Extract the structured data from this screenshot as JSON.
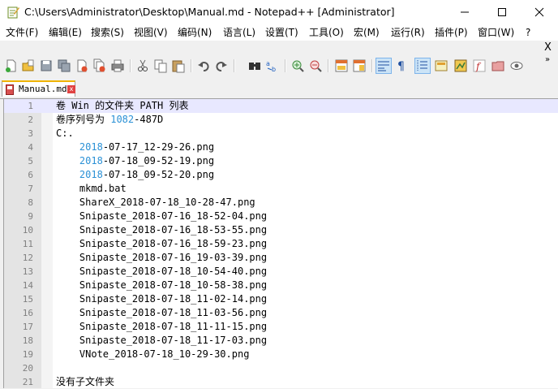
{
  "window": {
    "title": "C:\\Users\\Administrator\\Desktop\\Manual.md - Notepad++ [Administrator]",
    "icon": "notepad-app-icon"
  },
  "menu": {
    "items": [
      "文件(F)",
      "编辑(E)",
      "搜索(S)",
      "视图(V)",
      "编码(N)",
      "语言(L)",
      "设置(T)",
      "工具(O)",
      "宏(M)",
      "运行(R)",
      "插件(P)",
      "窗口(W)",
      "?"
    ],
    "close_doc": "X"
  },
  "toolbar": {
    "buttons": [
      "new-file-icon",
      "open-file-icon",
      "save-icon",
      "save-all-icon",
      "close-icon",
      "close-all-icon",
      "print-icon",
      "cut-icon",
      "copy-icon",
      "paste-icon",
      "undo-icon",
      "redo-icon",
      "find-icon",
      "replace-icon",
      "zoom-in-icon",
      "zoom-out-icon",
      "sync-vertical-icon",
      "sync-horizontal-icon",
      "word-wrap-icon",
      "show-all-chars-icon",
      "indent-guide-icon",
      "doc-map-icon",
      "function-list-icon",
      "folder-workspace-icon",
      "monitoring-icon",
      "record-macro-icon"
    ],
    "overflow": "»"
  },
  "tabs": [
    {
      "label": "Manual.md",
      "close": "x"
    }
  ],
  "editor": {
    "lines": [
      {
        "no": "1",
        "text": "卷 Win 的文件夹 PATH 列表"
      },
      {
        "no": "2",
        "pre": "卷序列号为 ",
        "num": "1082",
        "post": "-487D"
      },
      {
        "no": "3",
        "text": "C:."
      },
      {
        "no": "4",
        "pre": "    ",
        "num": "2018",
        "post": "-07-17_12-29-26.png"
      },
      {
        "no": "5",
        "pre": "    ",
        "num": "2018",
        "post": "-07-18_09-52-19.png"
      },
      {
        "no": "6",
        "pre": "    ",
        "num": "2018",
        "post": "-07-18_09-52-20.png"
      },
      {
        "no": "7",
        "text": "    mkmd.bat"
      },
      {
        "no": "8",
        "text": "    ShareX_2018-07-18_10-28-47.png"
      },
      {
        "no": "9",
        "text": "    Snipaste_2018-07-16_18-52-04.png"
      },
      {
        "no": "10",
        "text": "    Snipaste_2018-07-16_18-53-55.png"
      },
      {
        "no": "11",
        "text": "    Snipaste_2018-07-16_18-59-23.png"
      },
      {
        "no": "12",
        "text": "    Snipaste_2018-07-16_19-03-39.png"
      },
      {
        "no": "13",
        "text": "    Snipaste_2018-07-18_10-54-40.png"
      },
      {
        "no": "14",
        "text": "    Snipaste_2018-07-18_10-58-38.png"
      },
      {
        "no": "15",
        "text": "    Snipaste_2018-07-18_11-02-14.png"
      },
      {
        "no": "16",
        "text": "    Snipaste_2018-07-18_11-03-56.png"
      },
      {
        "no": "17",
        "text": "    Snipaste_2018-07-18_11-11-15.png"
      },
      {
        "no": "18",
        "text": "    Snipaste_2018-07-18_11-17-03.png"
      },
      {
        "no": "19",
        "text": "    VNote_2018-07-18_10-29-30.png"
      },
      {
        "no": "20",
        "text": ""
      },
      {
        "no": "21",
        "text": "没有子文件夹"
      }
    ],
    "current_line": "1"
  },
  "colors": {
    "number": "#2b91d6",
    "current_line_bg": "#e8e8ff",
    "tab_accent": "#f0b400"
  }
}
